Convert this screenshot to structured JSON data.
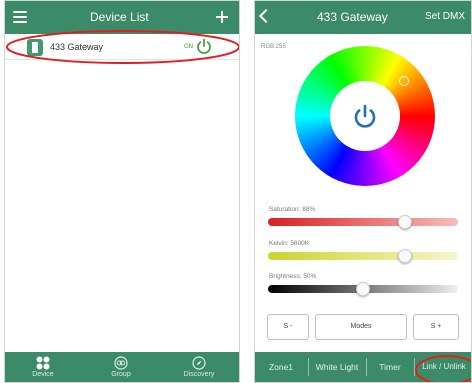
{
  "left": {
    "title": "Device List",
    "device": {
      "name": "433 Gateway",
      "status": "ON"
    },
    "tabs": [
      {
        "label": "Device",
        "icon": "grid-icon"
      },
      {
        "label": "Group",
        "icon": "group-icon"
      },
      {
        "label": "Discovery",
        "icon": "compass-icon"
      }
    ]
  },
  "right": {
    "title": "433 Gateway",
    "set_dmx": "Set DMX",
    "rgb": "RGB:255",
    "saturation": {
      "label": "Saturation: 88%",
      "value": 0.72
    },
    "kelvin": {
      "label": "Kelvin: 5600K",
      "value": 0.72
    },
    "brightness": {
      "label": "Brightness: 50%",
      "value": 0.5
    },
    "buttons": {
      "s_minus": "S -",
      "modes": "Modes",
      "s_plus": "S +"
    },
    "tabs": [
      "Zone1",
      "White Light",
      "Timer",
      "Link / Unlink"
    ]
  },
  "colors": {
    "accent": "#3b8a68",
    "power": "#1e72b8",
    "on": "#3aa03a",
    "highlight": "#e02020"
  }
}
